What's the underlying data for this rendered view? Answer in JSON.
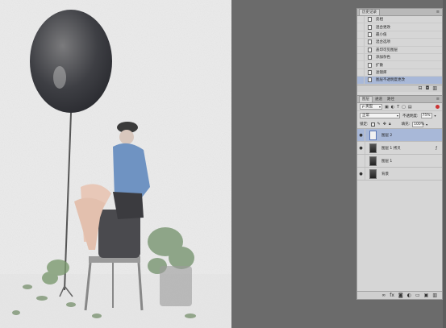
{
  "history_panel": {
    "tab": "历史记录",
    "menu_icon": "panel-menu-icon",
    "items": [
      {
        "label": "反相",
        "selected": false
      },
      {
        "label": "混合更改",
        "selected": false
      },
      {
        "label": "最小值",
        "selected": false
      },
      {
        "label": "混合选项",
        "selected": false
      },
      {
        "label": "盖印可见图层",
        "selected": false
      },
      {
        "label": "添加杂色",
        "selected": false
      },
      {
        "label": "扩散",
        "selected": false
      },
      {
        "label": "滤镜库",
        "selected": false
      },
      {
        "label": "图层不透明度更改",
        "selected": true
      }
    ],
    "footer_icons": [
      "new-document-from-state-icon",
      "camera-icon",
      "trash-icon"
    ]
  },
  "layers_panel": {
    "tabs": [
      "图层",
      "通道",
      "路径"
    ],
    "active_tab": "图层",
    "kind_filter": "ρ 类型",
    "filter_icons": [
      "image-filter-icon",
      "adjustment-filter-icon",
      "type-filter-icon",
      "shape-filter-icon",
      "smart-object-filter-icon"
    ],
    "blend_mode": "正常",
    "opacity_label": "不透明度:",
    "opacity_value": "75%",
    "lock_label": "锁定:",
    "fill_label": "填充:",
    "fill_value": "100%",
    "layers": [
      {
        "name": "图层 2",
        "visible": true,
        "selected": true,
        "thumb": "light"
      },
      {
        "name": "图层 1 拷贝",
        "visible": true,
        "selected": false,
        "thumb": "dark",
        "fx": true
      },
      {
        "name": "图层 1",
        "visible": false,
        "selected": false,
        "thumb": "dark"
      },
      {
        "name": "背景",
        "visible": true,
        "selected": false,
        "thumb": "dark"
      }
    ],
    "footer_icons": [
      "link-icon",
      "fx-icon",
      "mask-icon",
      "adjustment-icon",
      "group-icon",
      "new-layer-icon",
      "trash-icon"
    ]
  },
  "colors": {
    "selection": "#a8b8d8",
    "workspace": "#6b6b6b",
    "panel": "#d6d6d6"
  }
}
